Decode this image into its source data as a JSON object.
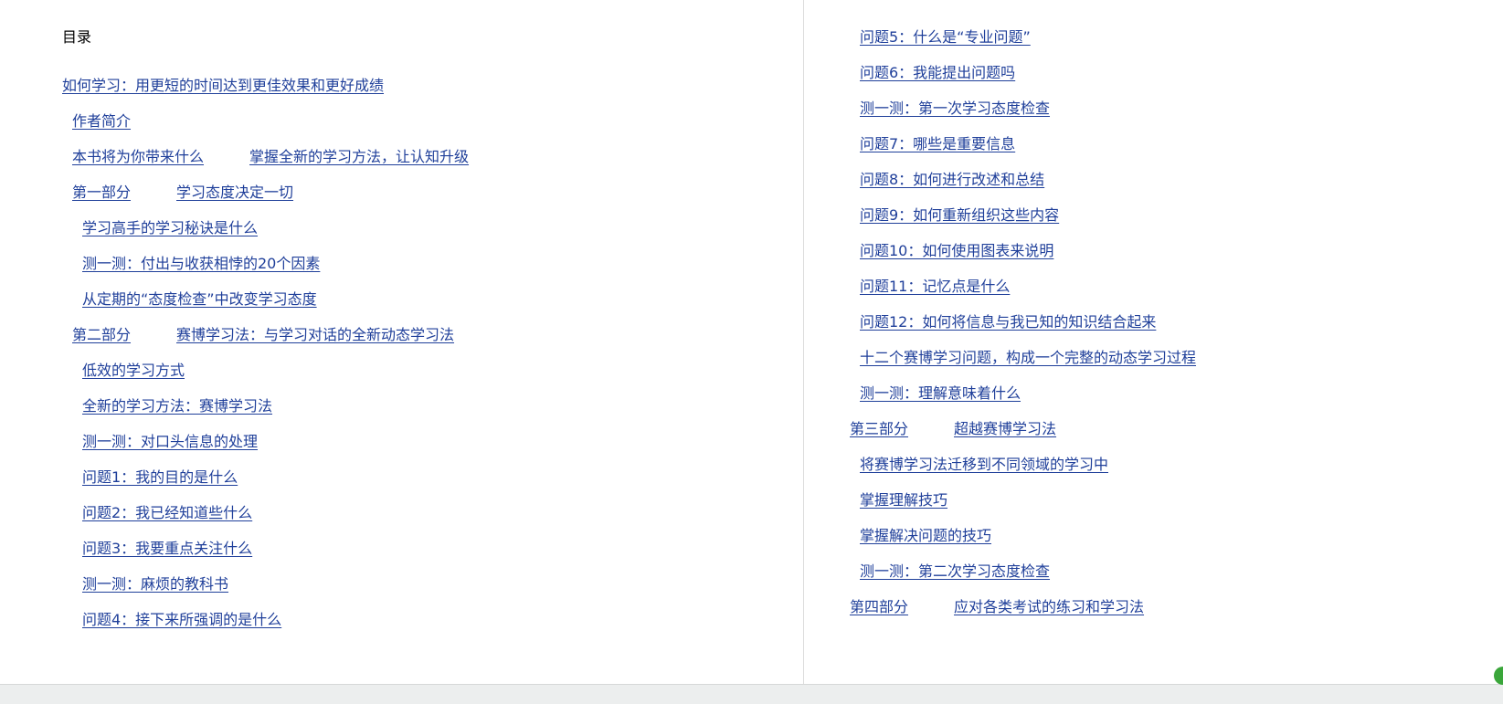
{
  "toc": {
    "title": "目录",
    "left_items": [
      "如何学习：用更短的时间达到更佳效果和更好成绩",
      "作者简介",
      [
        "本书将为你带来什么",
        "掌握全新的学习方法，让认知升级"
      ],
      [
        "第一部分",
        "学习态度决定一切"
      ],
      "学习高手的学习秘诀是什么",
      "测一测：付出与收获相悖的20个因素",
      "从定期的“态度检查”中改变学习态度",
      [
        "第二部分",
        "赛博学习法：与学习对话的全新动态学习法"
      ],
      "低效的学习方式",
      "全新的学习方法：赛博学习法",
      "测一测：对口头信息的处理",
      "问题1：我的目的是什么",
      "问题2：我已经知道些什么",
      "问题3：我要重点关注什么",
      "测一测：麻烦的教科书",
      "问题4：接下来所强调的是什么"
    ],
    "right_items": [
      "问题5：什么是“专业问题”",
      "问题6：我能提出问题吗",
      "测一测：第一次学习态度检查",
      "问题7：哪些是重要信息",
      "问题8：如何进行改述和总结",
      "问题9：如何重新组织这些内容",
      "问题10：如何使用图表来说明",
      "问题11：记忆点是什么",
      "问题12：如何将信息与我已知的知识结合起来",
      "十二个赛博学习问题，构成一个完整的动态学习过程",
      "测一测：理解意味着什么",
      [
        "第三部分",
        "超越赛博学习法"
      ],
      "将赛博学习法迁移到不同领域的学习中",
      "掌握理解技巧",
      "掌握解决问题的技巧",
      "测一测：第二次学习态度检查",
      [
        "第四部分",
        "应对各类考试的练习和学习法"
      ]
    ]
  },
  "colors": {
    "link": "#1f3f9a",
    "title": "#000000",
    "status_bar": "#eceeee",
    "badge": "#3aa63a"
  }
}
